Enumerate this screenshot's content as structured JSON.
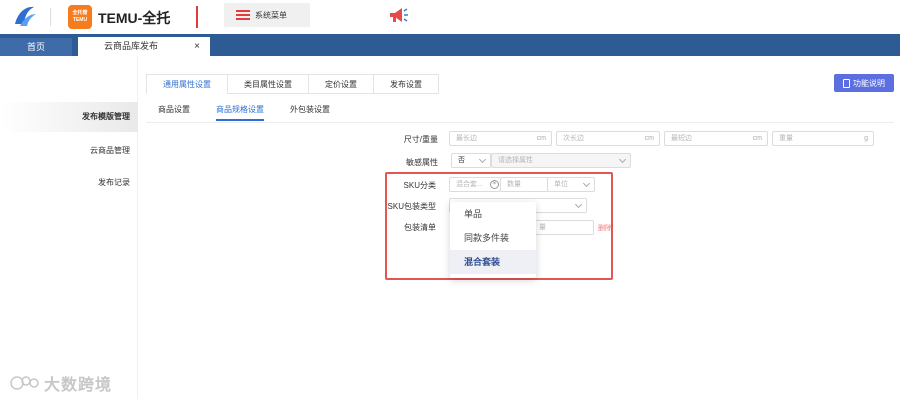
{
  "header": {
    "brand": "TEMU-全托",
    "temu_logo_text": "全托管 TEMU",
    "sys_menu": "系统菜单",
    "icons": [
      "bird-logo-icon",
      "menu-list-icon",
      "speaker-icon"
    ],
    "accent_red": "#e23b3b",
    "accent_orange": "#f57c1f"
  },
  "tabs": {
    "home": "首页",
    "active": "云商品库发布",
    "close": "×",
    "bar_color": "#2f5b95"
  },
  "sidebar": {
    "items": [
      {
        "label": "发布模版管理"
      },
      {
        "label": "云商品管理"
      },
      {
        "label": "发布记录"
      }
    ]
  },
  "watermark": "大数跨境",
  "main": {
    "top_tabs": [
      "通用属性设置",
      "类目属性设置",
      "定价设置",
      "发布设置"
    ],
    "help_button": "功能说明",
    "sub_tabs": [
      "商品设置",
      "商品规格设置",
      "外包装设置"
    ],
    "form": {
      "size_weight_label": "尺寸/重量",
      "size_fields": [
        {
          "placeholder": "最长边",
          "unit": "cm"
        },
        {
          "placeholder": "次长边",
          "unit": "cm"
        },
        {
          "placeholder": "最短边",
          "unit": "cm"
        },
        {
          "placeholder": "重量",
          "unit": "g"
        }
      ],
      "sensitive_label": "敏感属性",
      "sensitive_value": "否",
      "sensitive_placeholder": "请选择属性",
      "sku_class_label": "SKU分类",
      "sku_class_value": "混合套...",
      "quantity_placeholder": "数量",
      "unit_placeholder": "单位",
      "sku_pack_label": "SKU包装类型",
      "pack_list_label": "包装清单",
      "pack_qty_partial": "量",
      "delete_partial": "删除"
    },
    "dropdown": {
      "options": [
        "单品",
        "同款多件装",
        "混合套装"
      ],
      "selected": "混合套装"
    }
  }
}
